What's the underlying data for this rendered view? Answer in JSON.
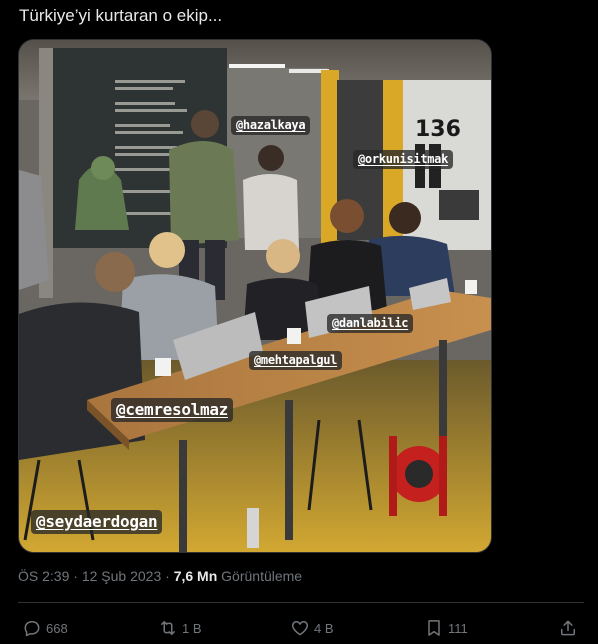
{
  "tweet": {
    "text": "Türkiye’yi kurtaran o ekip..."
  },
  "media": {
    "tags": [
      "@hazalkaya",
      "@orkunisitmak",
      "@danlabilic",
      "@mehtapalgul",
      "@cemresolmaz",
      "@seydaerdogan"
    ],
    "wall_number": "136"
  },
  "meta": {
    "time": "ÖS 2:39",
    "separator": "·",
    "date": "12 Şub 2023",
    "views_count": "7,6 Mn",
    "views_label": "Görüntüleme"
  },
  "actions": {
    "reply_count": "668",
    "retweet_count": "1 B",
    "like_count": "4 B",
    "bookmark_count": "111"
  },
  "colors": {
    "background": "#000000",
    "text": "#e7e9ea",
    "secondary": "#71767b",
    "border": "#2f3336"
  }
}
